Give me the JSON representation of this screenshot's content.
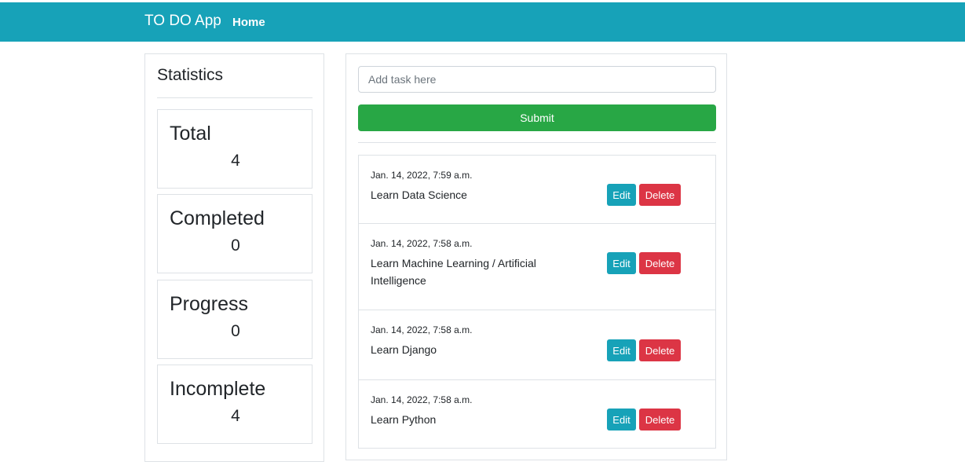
{
  "navbar": {
    "brand": "TO DO App",
    "home_link": "Home"
  },
  "stats": {
    "title": "Statistics",
    "cards": [
      {
        "label": "Total",
        "value": "4"
      },
      {
        "label": "Completed",
        "value": "0"
      },
      {
        "label": "Progress",
        "value": "0"
      },
      {
        "label": "Incomplete",
        "value": "4"
      }
    ]
  },
  "task_form": {
    "placeholder": "Add task here",
    "value": "",
    "submit_label": "Submit"
  },
  "tasks": [
    {
      "date": "Jan. 14, 2022, 7:59 a.m.",
      "text": "Learn Data Science",
      "edit_label": "Edit",
      "delete_label": "Delete"
    },
    {
      "date": "Jan. 14, 2022, 7:58 a.m.",
      "text": "Learn Machine Learning / Artificial Intelligence",
      "edit_label": "Edit",
      "delete_label": "Delete"
    },
    {
      "date": "Jan. 14, 2022, 7:58 a.m.",
      "text": "Learn Django",
      "edit_label": "Edit",
      "delete_label": "Delete"
    },
    {
      "date": "Jan. 14, 2022, 7:58 a.m.",
      "text": "Learn Python",
      "edit_label": "Edit",
      "delete_label": "Delete"
    }
  ],
  "colors": {
    "navbar": "#17a2b8",
    "submit": "#28a745",
    "edit": "#17a2b8",
    "delete": "#dc3545"
  }
}
